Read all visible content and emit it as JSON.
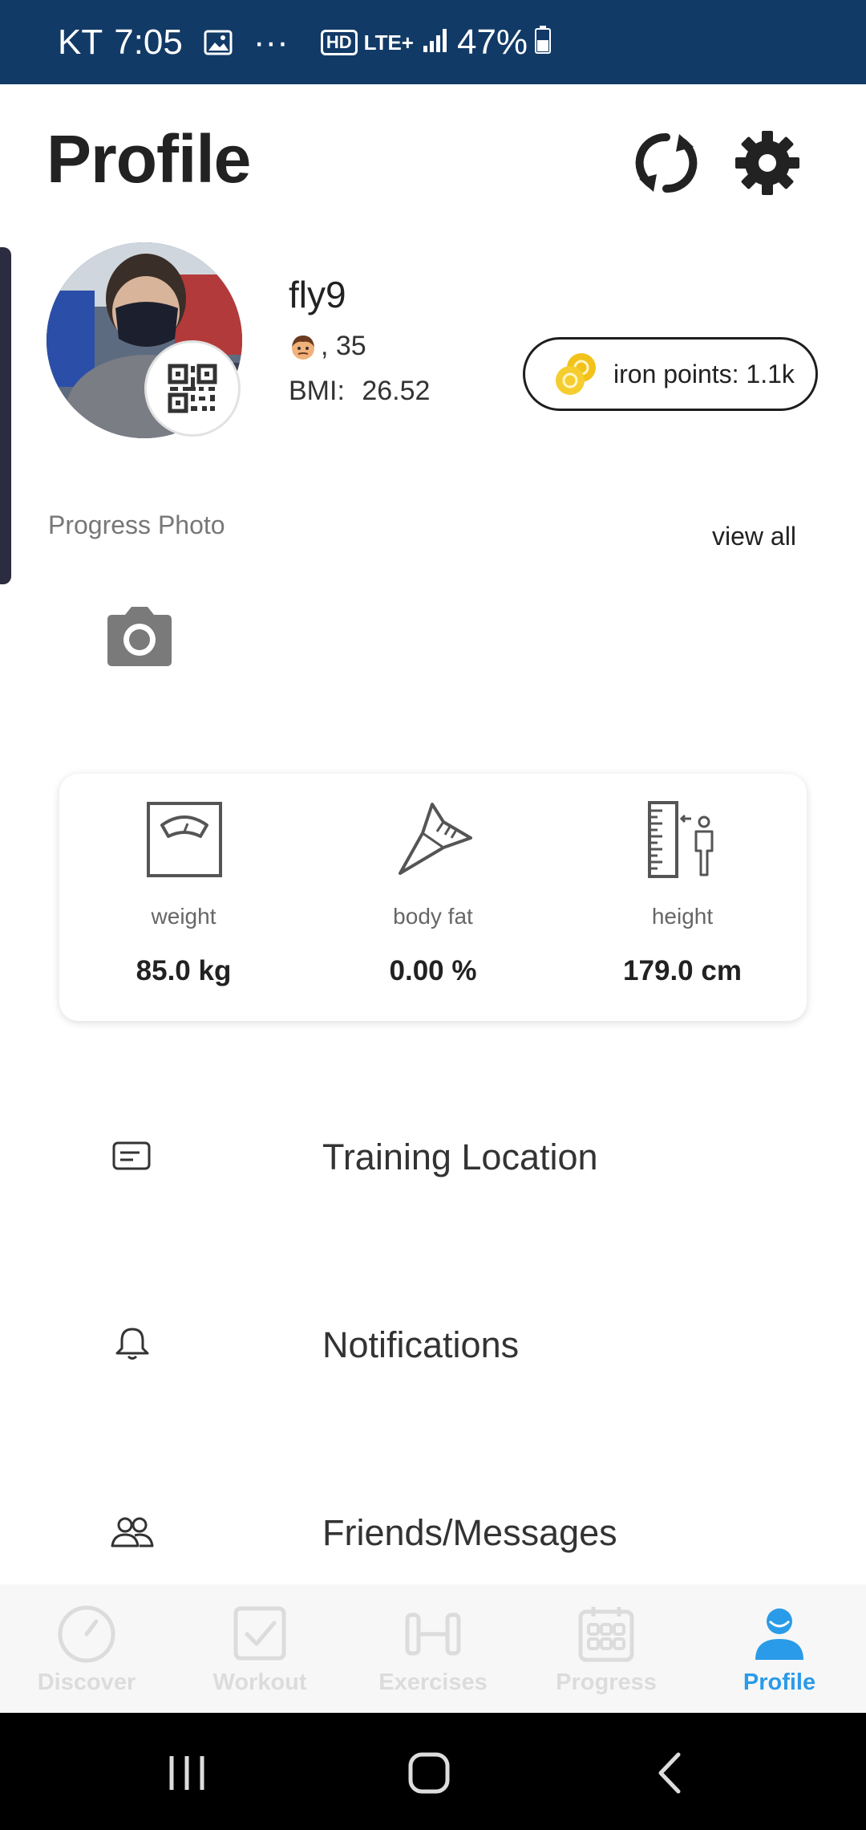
{
  "status_bar": {
    "carrier": "KT",
    "time": "7:05",
    "more": "···",
    "hd": "HD",
    "network": "LTE+",
    "battery": "47%"
  },
  "header": {
    "title": "Profile",
    "sync_icon": "sync-icon",
    "settings_icon": "gear-icon"
  },
  "profile": {
    "username": "fly9",
    "age": ", 35",
    "bmi_label": "BMI:",
    "bmi_value": "26.52",
    "qr_icon": "qr-code-icon",
    "iron_points": "iron points: 1.1k"
  },
  "progress_photo": {
    "label": "Progress Photo",
    "view_all": "view all",
    "camera_icon": "camera-icon"
  },
  "stats": [
    {
      "label": "weight",
      "value": "85.0  kg",
      "icon": "scale-icon"
    },
    {
      "label": "body fat",
      "value": "0.00 %",
      "icon": "caliper-icon"
    },
    {
      "label": "height",
      "value": "179.0  cm",
      "icon": "height-ruler-icon"
    }
  ],
  "menu": [
    {
      "label": "Training Location",
      "icon": "location-card-icon"
    },
    {
      "label": "Notifications",
      "icon": "bell-icon"
    },
    {
      "label": "Friends/Messages",
      "icon": "friends-icon"
    }
  ],
  "bottom_nav": [
    {
      "label": "Discover",
      "icon": "compass-icon",
      "active": false
    },
    {
      "label": "Workout",
      "icon": "checkbox-icon",
      "active": false
    },
    {
      "label": "Exercises",
      "icon": "dumbbell-icon",
      "active": false
    },
    {
      "label": "Progress",
      "icon": "calendar-icon",
      "active": false
    },
    {
      "label": "Profile",
      "icon": "person-icon",
      "active": true
    }
  ],
  "colors": {
    "status_bar": "#123a66",
    "accent": "#2a9be8",
    "nav_inactive": "#dcdcdc",
    "coin": "#f2c21b"
  }
}
